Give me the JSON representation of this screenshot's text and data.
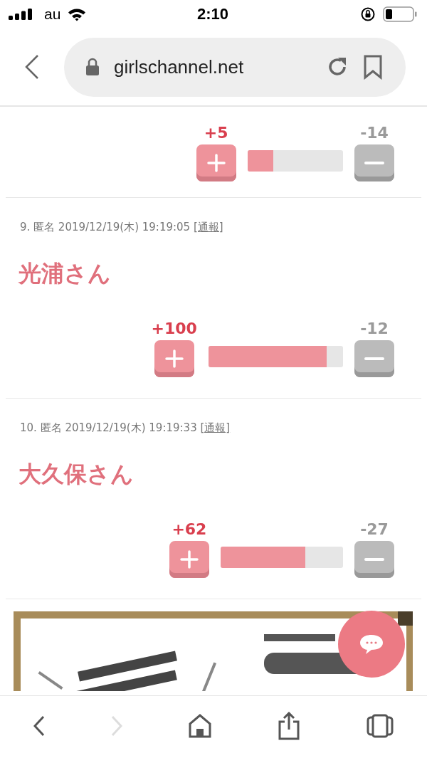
{
  "status_bar": {
    "carrier": "au",
    "time": "2:10"
  },
  "address_bar": {
    "url": "girlschannel.net"
  },
  "comments": [
    {
      "plus": "+5",
      "minus": "-14",
      "level": 0.27
    },
    {
      "header": "9. 匿名 2019/12/19(木) 19:19:05 ",
      "report": "[通報]",
      "title": "光浦さん",
      "plus": "+100",
      "minus": "-12",
      "level": 0.88
    },
    {
      "header": "10. 匿名 2019/12/19(木) 19:19:33 ",
      "report": "[通報]",
      "title": "大久保さん",
      "plus": "+62",
      "minus": "-27",
      "level": 0.69
    }
  ],
  "toolbar": [
    {
      "kind": "back",
      "disabled": false
    },
    {
      "kind": "forward",
      "disabled": true
    },
    {
      "kind": "home",
      "disabled": false
    },
    {
      "kind": "share",
      "disabled": false
    },
    {
      "kind": "tabs",
      "disabled": false
    }
  ]
}
